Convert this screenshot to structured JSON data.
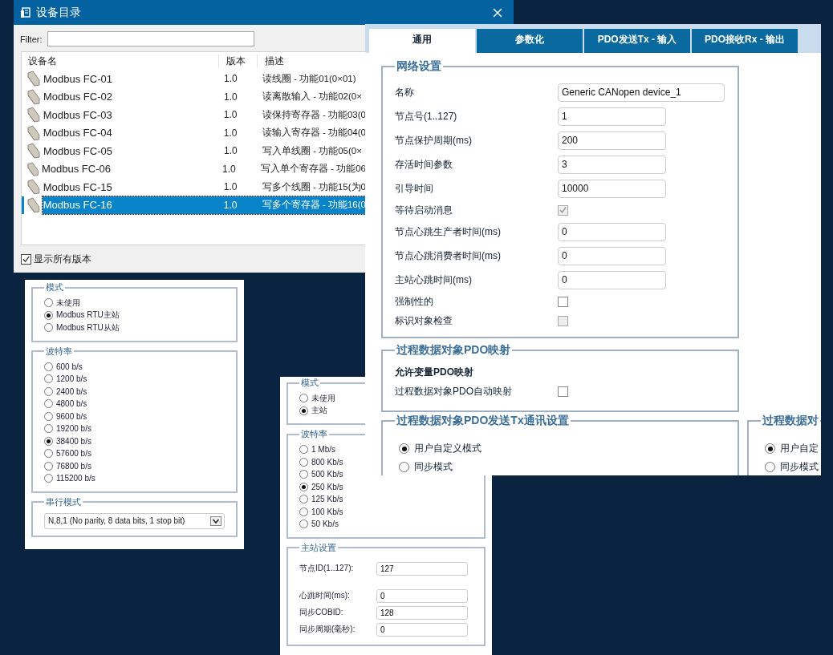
{
  "device_dialog": {
    "title": "设备目录",
    "filter_label": "Filter:",
    "columns": [
      "设备名",
      "版本",
      "描述"
    ],
    "rows": [
      {
        "name": "Modbus FC-01",
        "version": "1.0",
        "description": "读线圈 - 功能01(0×01)",
        "selected": false
      },
      {
        "name": "Modbus FC-02",
        "version": "1.0",
        "description": "读离散输入 - 功能02(0×",
        "selected": false
      },
      {
        "name": "Modbus FC-03",
        "version": "1.0",
        "description": "读保持寄存器 - 功能03(0",
        "selected": false
      },
      {
        "name": "Modbus FC-04",
        "version": "1.0",
        "description": "读输入寄存器 - 功能04(0",
        "selected": false
      },
      {
        "name": "Modbus FC-05",
        "version": "1.0",
        "description": "写入单线圈 - 功能05(0×",
        "selected": false
      },
      {
        "name": "Modbus FC-06",
        "version": "1.0",
        "description": "写入单个寄存器 - 功能06",
        "selected": false
      },
      {
        "name": "Modbus FC-15",
        "version": "1.0",
        "description": "写多个线圈 - 功能15(为0",
        "selected": false
      },
      {
        "name": "Modbus FC-16",
        "version": "1.0",
        "description": "写多个寄存器 - 功能16(0",
        "selected": true
      }
    ],
    "show_all_versions": {
      "label": "显示所有版本",
      "checked": true
    }
  },
  "general_panel": {
    "tabs": [
      {
        "label": "通用",
        "selected": true
      },
      {
        "label": "参数化",
        "selected": false
      },
      {
        "label": "PDO发送Tx - 输入",
        "selected": false
      },
      {
        "label": "PDO接收Rx - 输出",
        "selected": false
      }
    ],
    "network_settings": {
      "legend": "网络设置",
      "rows": [
        {
          "kind": "text",
          "label": "名称",
          "value": "Generic CANopen device_1",
          "wide": true
        },
        {
          "kind": "text",
          "label": "节点号(1..127)",
          "value": "1",
          "wide": false
        },
        {
          "kind": "text",
          "label": "节点保护周期(ms)",
          "value": "200",
          "wide": false
        },
        {
          "kind": "text",
          "label": "存活时间参数",
          "value": "3",
          "wide": false
        },
        {
          "kind": "text",
          "label": "引导时间",
          "value": "10000",
          "wide": false
        },
        {
          "kind": "checkbox",
          "label": "等待启动消息",
          "checked": true,
          "disabled": true
        },
        {
          "kind": "text",
          "label": "节点心跳生产者时间(ms)",
          "value": "0",
          "wide": false
        },
        {
          "kind": "text",
          "label": "节点心跳消费者时间(ms)",
          "value": "0",
          "wide": false
        },
        {
          "kind": "text",
          "label": "主站心跳时间(ms)",
          "value": "0",
          "wide": false
        },
        {
          "kind": "checkbox",
          "label": "强制性的",
          "checked": false,
          "disabled": false
        },
        {
          "kind": "checkbox",
          "label": "标识对象检查",
          "checked": false,
          "disabled": true
        }
      ]
    },
    "pdo_mapping": {
      "legend": "过程数据对象PDO映射",
      "heading": "允许变量PDO映射",
      "rows": [
        {
          "label": "过程数据对象PDO自动映射",
          "checked": false
        }
      ]
    },
    "tx_settings": {
      "legend": "过程数据对象PDO发送Tx通讯设置",
      "options": [
        {
          "label": "用户自定义模式",
          "selected": true
        },
        {
          "label": "同步模式",
          "selected": false
        }
      ]
    },
    "second_settings": {
      "legend": "过程数据对",
      "options": [
        {
          "label": "用户自定",
          "selected": true
        },
        {
          "label": "同步模式",
          "selected": false
        }
      ]
    }
  },
  "rtu_panel": {
    "mode": {
      "legend": "模式",
      "options": [
        {
          "label": "未使用",
          "selected": false
        },
        {
          "label": "Modbus RTU主站",
          "selected": true
        },
        {
          "label": "Modbus RTU从站",
          "selected": false
        }
      ]
    },
    "baud": {
      "legend": "波特率",
      "options": [
        {
          "label": "600 b/s",
          "selected": false
        },
        {
          "label": "1200 b/s",
          "selected": false
        },
        {
          "label": "2400 b/s",
          "selected": false
        },
        {
          "label": "4800 b/s",
          "selected": false
        },
        {
          "label": "9600 b/s",
          "selected": false
        },
        {
          "label": "19200 b/s",
          "selected": false
        },
        {
          "label": "38400 b/s",
          "selected": true
        },
        {
          "label": "57600 b/s",
          "selected": false
        },
        {
          "label": "76800 b/s",
          "selected": false
        },
        {
          "label": "115200 b/s",
          "selected": false
        }
      ]
    },
    "serial": {
      "legend": "串行模式",
      "value": "N,8,1 (No parity, 8 data bits, 1 stop bit)"
    }
  },
  "master_panel": {
    "mode": {
      "legend": "模式",
      "options": [
        {
          "label": "未使用",
          "selected": false
        },
        {
          "label": "主站",
          "selected": true
        }
      ]
    },
    "baud": {
      "legend": "波特率",
      "options": [
        {
          "label": "1 Mb/s",
          "selected": false
        },
        {
          "label": "800 Kb/s",
          "selected": false
        },
        {
          "label": "500 Kb/s",
          "selected": false
        },
        {
          "label": "250 Kb/s",
          "selected": true
        },
        {
          "label": "125 Kb/s",
          "selected": false
        },
        {
          "label": "100 Kb/s",
          "selected": false
        },
        {
          "label": "50 Kb/s",
          "selected": false
        }
      ]
    },
    "master_settings": {
      "legend": "主站设置",
      "fields": [
        {
          "label": "节点ID(1..127):",
          "value": "127"
        },
        {
          "label": "心跳时间(ms):",
          "value": "0"
        },
        {
          "label": "同步COBID:",
          "value": "128"
        },
        {
          "label": "同步周期(毫秒):",
          "value": "0"
        }
      ]
    }
  }
}
